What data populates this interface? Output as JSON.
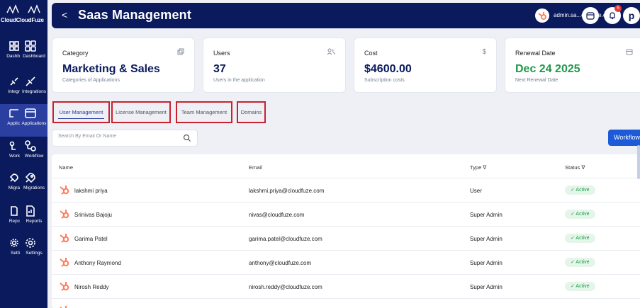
{
  "sidebar": {
    "brand": "CloudCloudFuze",
    "items": [
      {
        "label_short": "Dashb",
        "label": "Dashboard"
      },
      {
        "label_short": "Integr",
        "label": "Integrations"
      },
      {
        "label_short": "Applic",
        "label": "Applications"
      },
      {
        "label_short": "Work",
        "label": "Workflow"
      },
      {
        "label_short": "Migra",
        "label": "Migrations"
      },
      {
        "label_short": "Repc",
        "label": "Reports"
      },
      {
        "label_short": "Setti",
        "label": "Settings"
      }
    ]
  },
  "header": {
    "back": "<",
    "title": "Saas Management",
    "account": "admin.sa...oudfuze.com",
    "notification_count": "5",
    "avatar": "p"
  },
  "cards": [
    {
      "label": "Category",
      "value": "Marketing & Sales",
      "sub": "Categories of Applications",
      "icon": "copy-icon"
    },
    {
      "label": "Users",
      "value": "37",
      "sub": "Users in the application",
      "icon": "users-icon"
    },
    {
      "label": "Cost",
      "value": "$4600.00",
      "sub": "Subscription costs",
      "icon": "dollar-icon"
    },
    {
      "label": "Renewal Date",
      "value": "Dec 24 2025",
      "sub": "Next Renewal Date",
      "icon": "calendar-icon"
    }
  ],
  "tabs": [
    {
      "label": "User Management",
      "active": true
    },
    {
      "label": "License Management",
      "active": false
    },
    {
      "label": "Team Management",
      "active": false
    },
    {
      "label": "Domains",
      "active": false
    }
  ],
  "search": {
    "placeholder": "Search By Email Or Name"
  },
  "workflow_button": "Workflow",
  "table": {
    "columns": {
      "name": "Name",
      "email": "Email",
      "type": "Type ∇",
      "status": "Status ∇"
    },
    "rows": [
      {
        "name": "lakshmi priya",
        "email": "lakshmi.priya@cloudfuze.com",
        "type": "User",
        "status": "✓ Active"
      },
      {
        "name": "Srinivas Bajoju",
        "email": "nivas@cloudfuze.com",
        "type": "Super Admin",
        "status": "✓ Active"
      },
      {
        "name": "Garima Patel",
        "email": "garima.patel@cloudfuze.com",
        "type": "Super Admin",
        "status": "✓ Active"
      },
      {
        "name": "Anthony Raymond",
        "email": "anthony@cloudfuze.com",
        "type": "Super Admin",
        "status": "✓ Active"
      },
      {
        "name": "Nirosh Reddy",
        "email": "nirosh.reddy@cloudfuze.com",
        "type": "Super Admin",
        "status": "✓ Active"
      }
    ]
  },
  "colors": {
    "sidebar": "#0a1a5c",
    "accent": "#1d5ad8",
    "active_green": "#1f9a4a",
    "highlight": "#c9222e",
    "hubspot": "#ff7a59"
  }
}
